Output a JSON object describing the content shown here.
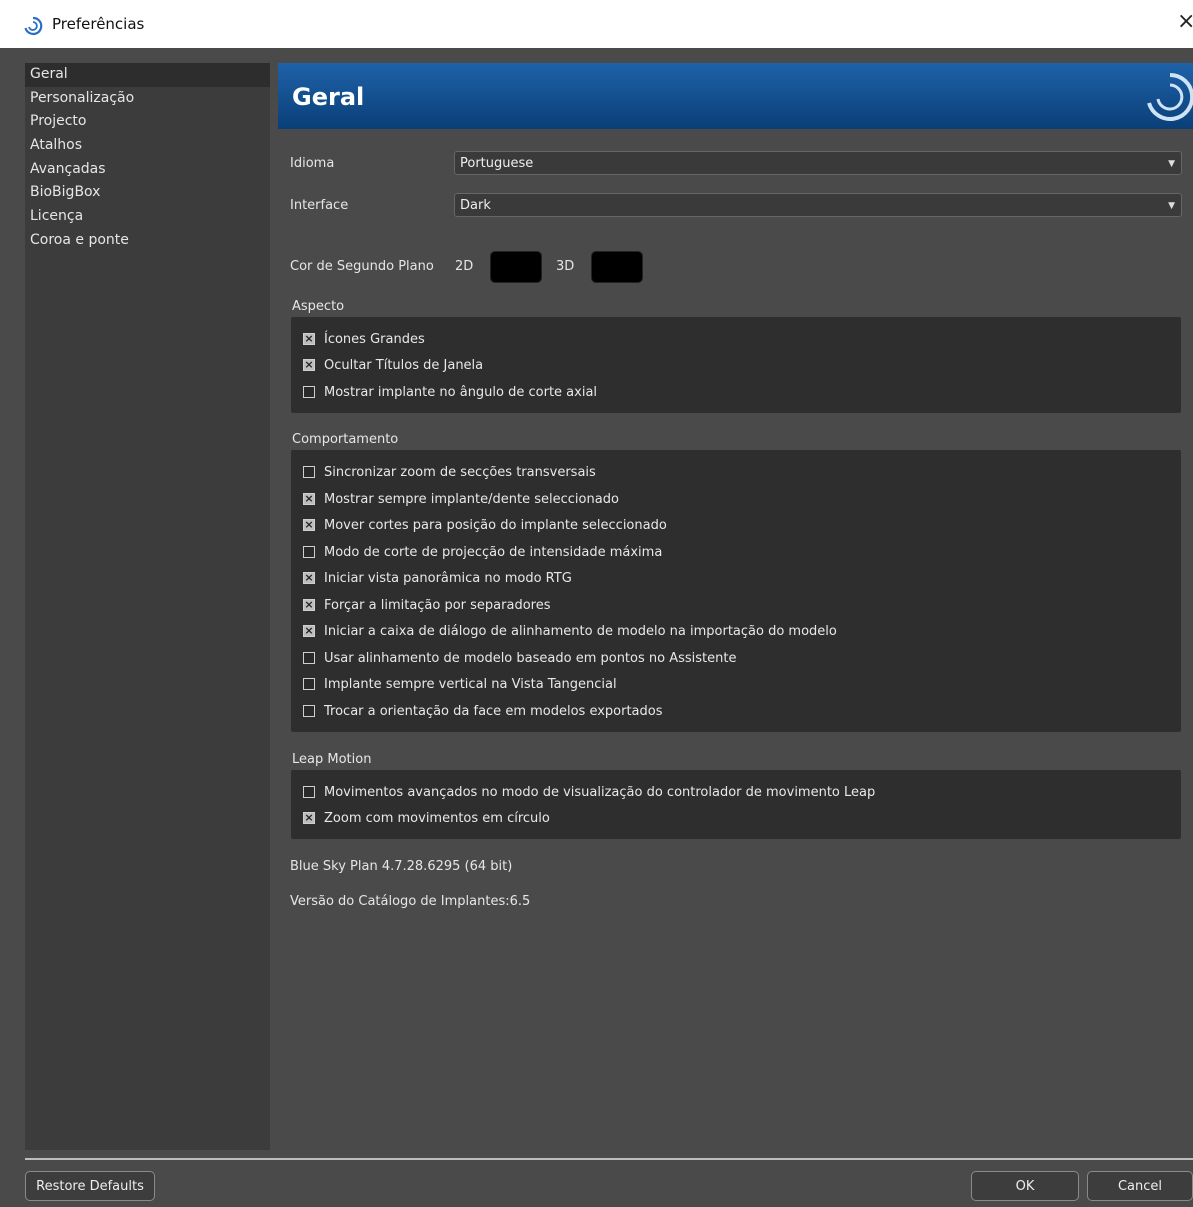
{
  "window": {
    "title": "Preferências",
    "close_icon": "×"
  },
  "sidebar": {
    "items": [
      {
        "label": "Geral"
      },
      {
        "label": "Personalização"
      },
      {
        "label": "Projecto"
      },
      {
        "label": "Atalhos"
      },
      {
        "label": "Avançadas"
      },
      {
        "label": "BioBigBox"
      },
      {
        "label": "Licença"
      },
      {
        "label": "Coroa e ponte"
      }
    ]
  },
  "header": {
    "title": "Geral",
    "logo_icon": "blue-sky-logo-icon"
  },
  "general": {
    "language_label": "Idioma",
    "language_value": "Portuguese",
    "interface_label": "Interface",
    "interface_value": "Dark",
    "bg_color_label": "Cor de Segundo Plano",
    "bg_2d_label": "2D",
    "bg_3d_label": "3D",
    "bg_2d_color": "#000000",
    "bg_3d_color": "#000000"
  },
  "aspect": {
    "title": "Aspecto",
    "options": [
      {
        "label": "Ícones Grandes",
        "checked": true
      },
      {
        "label": "Ocultar Títulos de Janela",
        "checked": true
      },
      {
        "label": "Mostrar implante no ângulo de corte axial",
        "checked": false
      }
    ]
  },
  "behavior": {
    "title": "Comportamento",
    "options": [
      {
        "label": "Sincronizar zoom de secções transversais",
        "checked": false
      },
      {
        "label": "Mostrar sempre implante/dente seleccionado",
        "checked": true
      },
      {
        "label": "Mover cortes para posição do implante seleccionado",
        "checked": true
      },
      {
        "label": "Modo de corte de projecção de intensidade máxima",
        "checked": false
      },
      {
        "label": "Iniciar vista panorâmica no modo RTG",
        "checked": true
      },
      {
        "label": "Forçar a limitação por separadores",
        "checked": true
      },
      {
        "label": "Iniciar a caixa de diálogo de alinhamento de modelo na importação do modelo",
        "checked": true
      },
      {
        "label": "Usar alinhamento de modelo baseado em pontos no Assistente",
        "checked": false
      },
      {
        "label": "Implante sempre vertical na Vista Tangencial",
        "checked": false
      },
      {
        "label": "Trocar a orientação da face em modelos exportados",
        "checked": false
      }
    ]
  },
  "leap": {
    "title": "Leap Motion",
    "options": [
      {
        "label": "Movimentos avançados no modo de visualização do controlador de movimento Leap",
        "checked": false
      },
      {
        "label": "Zoom com movimentos em círculo",
        "checked": true
      }
    ]
  },
  "info": {
    "version": "Blue Sky Plan 4.7.28.6295 (64 bit)",
    "catalog": "Versão do Catálogo de Implantes:6.5"
  },
  "footer": {
    "restore_label": "Restore Defaults",
    "ok_label": "OK",
    "cancel_label": "Cancel"
  }
}
